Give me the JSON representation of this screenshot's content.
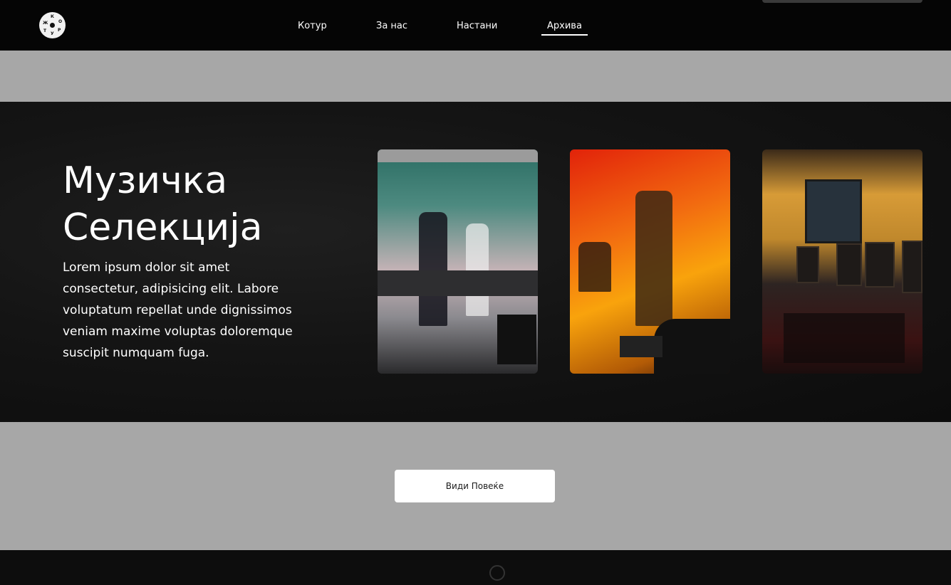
{
  "nav": {
    "logo_letters": [
      "Ж",
      "К",
      "О",
      "Т",
      "У",
      "Р"
    ],
    "links": [
      {
        "label": "Котур"
      },
      {
        "label": "За нас"
      },
      {
        "label": "Настани"
      },
      {
        "label": "Архива",
        "active": true
      }
    ]
  },
  "hero": {
    "title_line1": "Музичка",
    "title_line2": "Селекција",
    "body": "Lorem ipsum dolor sit amet consectetur, adipisicing elit. Labore voluptatum repellat unde dignissimos veniam maxime voluptas doloremque suscipit numquam fuga."
  },
  "gallery": [
    {
      "image": "dj-performance-photo"
    },
    {
      "image": "violinist-concert-photo"
    },
    {
      "image": "venue-interior-photo"
    }
  ],
  "more_button": {
    "label": "Види Повеќе"
  },
  "colors": {
    "nav_bg": "#050505",
    "gray_band": "#a7a7a7",
    "hero_bg": "#141414",
    "text": "#ffffff",
    "button_bg": "#ffffff"
  }
}
